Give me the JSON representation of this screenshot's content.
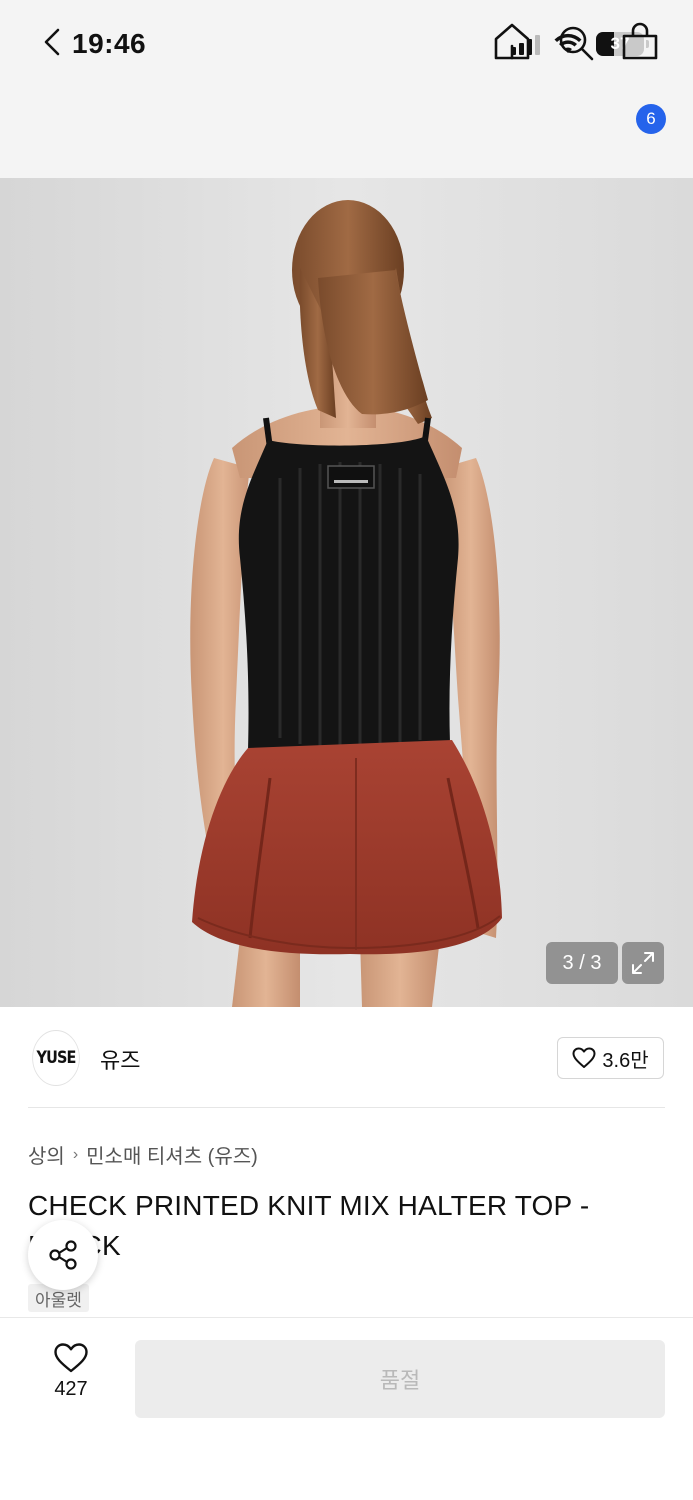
{
  "status_bar": {
    "time": "19:46",
    "battery": "37"
  },
  "nav": {
    "cart_count": "6"
  },
  "gallery": {
    "counter": "3 / 3"
  },
  "brand": {
    "logo_text": "YUSE",
    "name": "유즈",
    "favorite_count": "3.6만"
  },
  "breadcrumb": {
    "category": "상의",
    "subcategory": "민소매 티셔츠 (유즈)"
  },
  "product": {
    "title": "CHECK PRINTED KNIT MIX HALTER TOP - BLACK",
    "tag": "아울렛"
  },
  "bottom_bar": {
    "like_count": "427",
    "purchase_label": "품절"
  },
  "colors": {
    "accent": "#2563eb",
    "top_black": "#111111",
    "skirt_red": "#a83a2a",
    "background": "#e0e0e0"
  }
}
